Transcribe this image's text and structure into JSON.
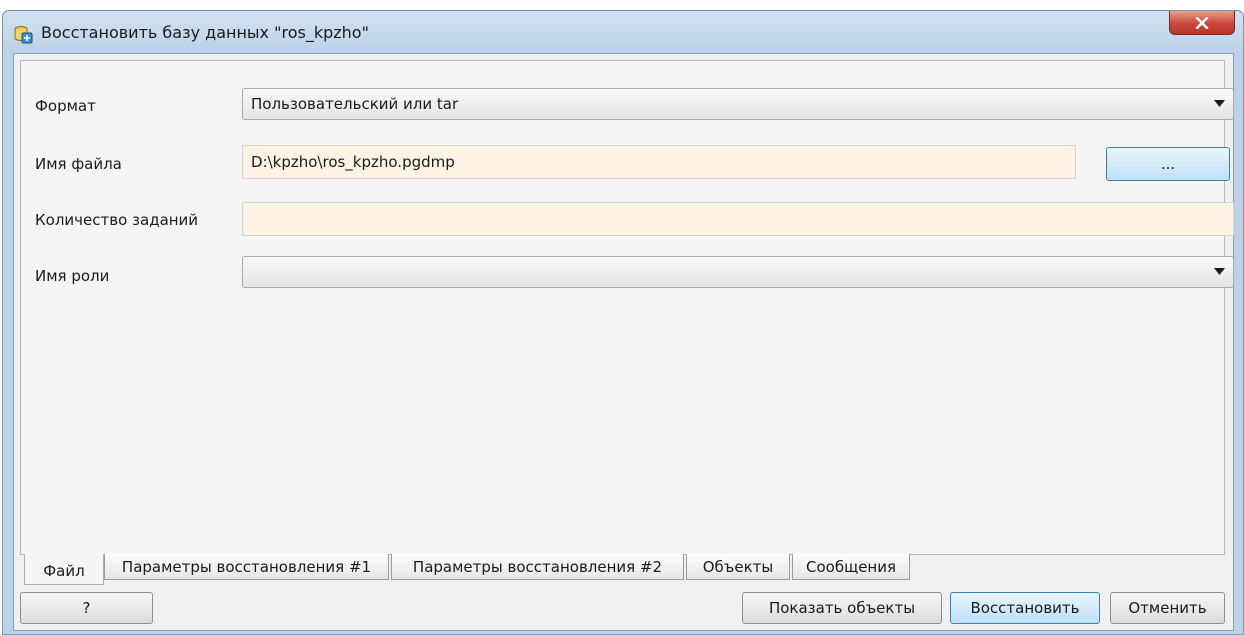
{
  "window": {
    "title": "Восстановить базу данных \"ros_kpzho\"",
    "close_label": "x"
  },
  "form": {
    "format": {
      "label": "Формат",
      "value": "Пользовательский или tar"
    },
    "filename": {
      "label": "Имя файла",
      "value": "D:\\kpzho\\ros_kpzho.pgdmp",
      "browse_label": "..."
    },
    "jobs": {
      "label": "Количество заданий",
      "value": ""
    },
    "role": {
      "label": "Имя роли",
      "value": ""
    }
  },
  "tabs": [
    {
      "label": "Файл",
      "active": true
    },
    {
      "label": "Параметры восстановления #1"
    },
    {
      "label": "Параметры восстановления #2"
    },
    {
      "label": "Объекты"
    },
    {
      "label": "Сообщения"
    }
  ],
  "buttons": {
    "help": "?",
    "show_objects": "Показать объекты",
    "restore": "Восстановить",
    "cancel": "Отменить"
  },
  "colors": {
    "field_bg": "#fff3e6",
    "focus_button": "#bfe0f7",
    "close_red": "#c8473a"
  }
}
